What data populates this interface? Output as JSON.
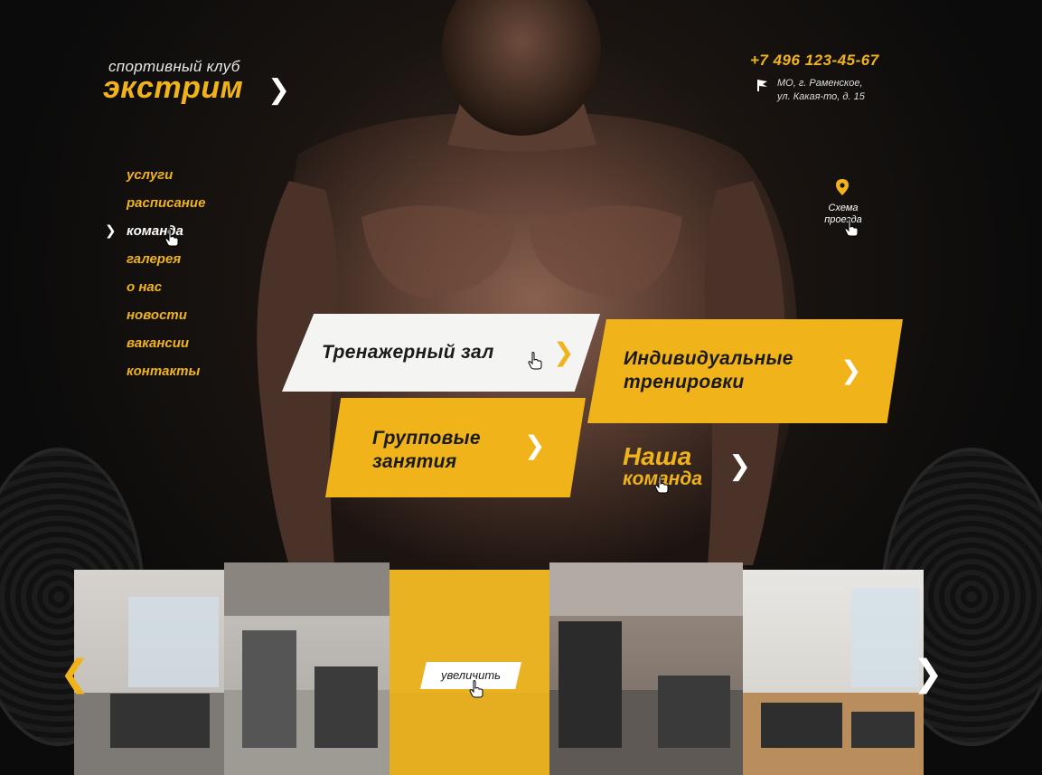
{
  "brand": {
    "subtitle": "спортивный клуб",
    "name": "экстрим"
  },
  "contacts": {
    "phone": "+7 496 123-45-67",
    "address_line1": "МО, г. Раменское,",
    "address_line2": "ул. Какая-то, д. 15"
  },
  "nav": {
    "items": [
      {
        "label": "услуги"
      },
      {
        "label": "расписание"
      },
      {
        "label": "команда",
        "active": true
      },
      {
        "label": "галерея"
      },
      {
        "label": "о нас"
      },
      {
        "label": "новости"
      },
      {
        "label": "вакансии"
      },
      {
        "label": "контакты"
      }
    ]
  },
  "route": {
    "label_line1": "Схема",
    "label_line2": "проезда"
  },
  "tiles": {
    "gym": "Тренажерный зал",
    "individual_line1": "Индивидуальные",
    "individual_line2": "тренировки",
    "group_line1": "Групповые",
    "group_line2": "занятия",
    "team_line1": "Наша",
    "team_line2": "команда"
  },
  "gallery": {
    "zoom_label": "увеличить"
  },
  "colors": {
    "accent": "#f0b41a",
    "background": "#0d0d0d",
    "light_tile": "#f4f4f2"
  },
  "icons": [
    "chevron-right-icon",
    "flag-icon",
    "map-pin-icon",
    "hand-cursor-icon",
    "chevron-left-icon"
  ]
}
